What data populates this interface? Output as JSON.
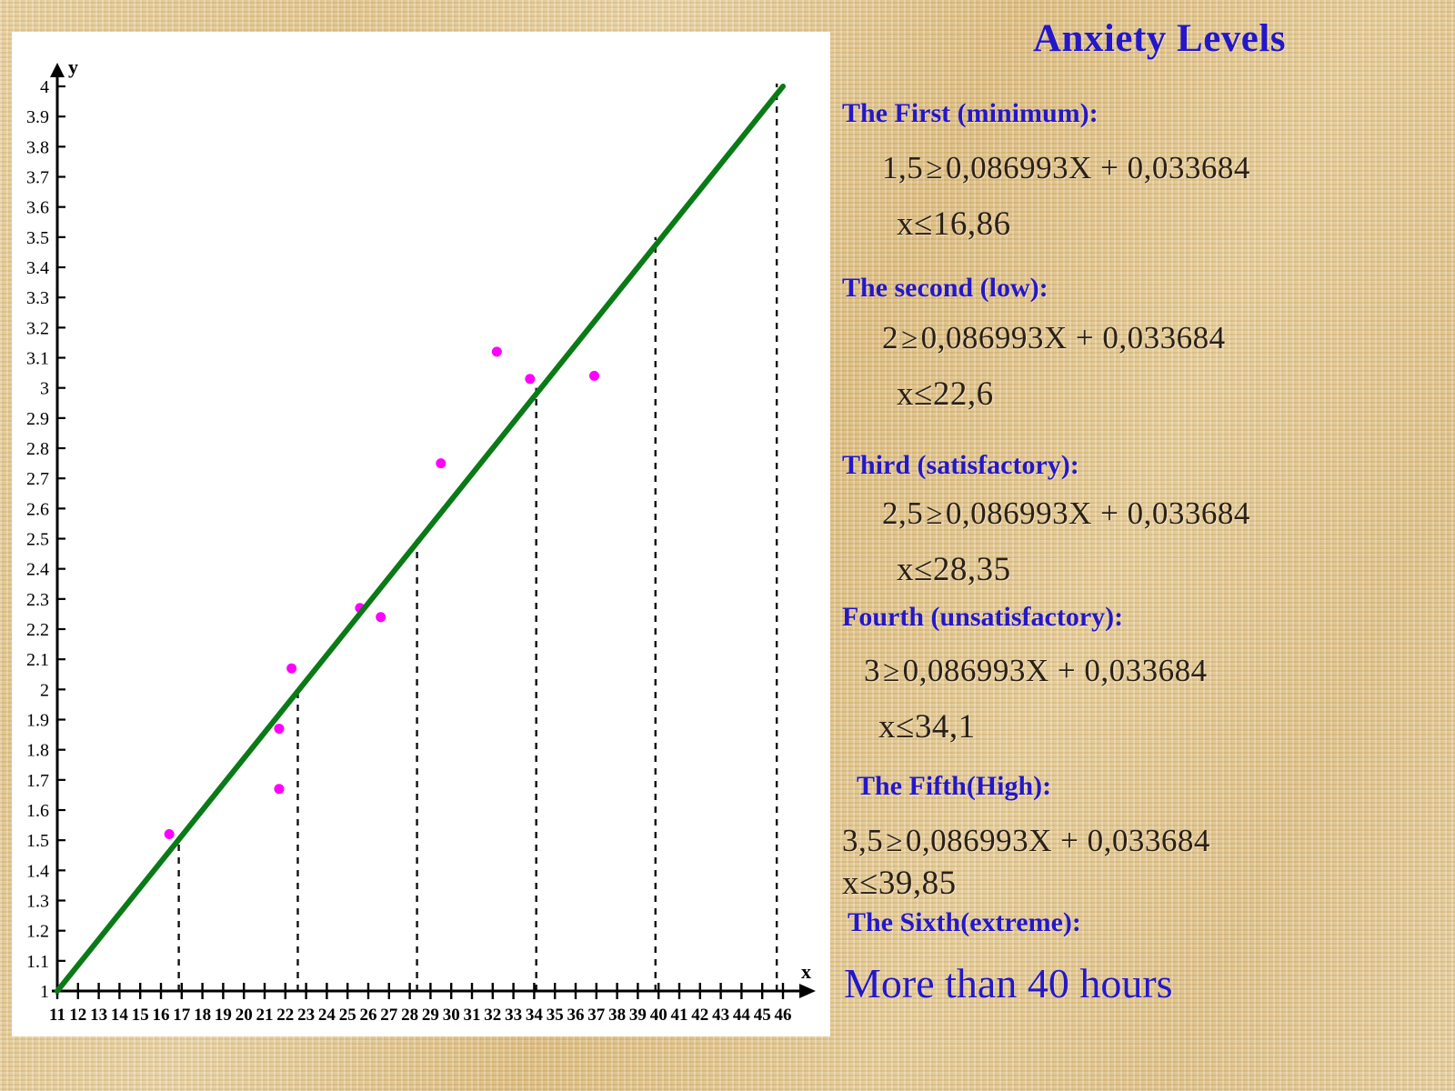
{
  "title": "Anxiety Levels",
  "colors": {
    "heading": "#2417c8",
    "formula": "#2b2014",
    "regression_line": "#0a7a16",
    "points": "#ff00ff",
    "background": "#e3c88f",
    "panel": "#ffffff"
  },
  "levels": [
    {
      "heading": "The First (minimum):",
      "formula_left": "1,5",
      "formula_rel": "≥",
      "formula_right": "0,086993X + 0,033684",
      "solution_var": "x",
      "solution_rel": "≤",
      "solution_value": "16,86"
    },
    {
      "heading": "The  second (low):",
      "formula_left": "2",
      "formula_rel": "≥",
      "formula_right": "0,086993X + 0,033684",
      "solution_var": "x",
      "solution_rel": "≤",
      "solution_value": "22,6"
    },
    {
      "heading": "Third (satisfactory):",
      "formula_left": "2,5",
      "formula_rel": "≥",
      "formula_right": "0,086993X + 0,033684",
      "solution_var": "x",
      "solution_rel": "≤",
      "solution_value": "28,35"
    },
    {
      "heading": "Fourth (unsatisfactory):",
      "formula_left": "3",
      "formula_rel": "≥",
      "formula_right": "0,086993X + 0,033684",
      "solution_var": "x",
      "solution_rel": "≤",
      "solution_value": "34,1"
    },
    {
      "heading": "The Fifth(High):",
      "formula_left": "3,5",
      "formula_rel": "≥",
      "formula_right": "0,086993X + 0,033684",
      "solution_var": "x",
      "solution_rel": "≤",
      "solution_value": "39,85"
    },
    {
      "heading": "The Sixth(extreme):",
      "conclusion": "More than 40 hours"
    }
  ],
  "chart_data": {
    "type": "scatter",
    "title": "",
    "xlabel": "x",
    "ylabel": "y",
    "xlim": [
      11,
      46
    ],
    "ylim": [
      1,
      4
    ],
    "xticks": [
      11,
      12,
      13,
      14,
      15,
      16,
      17,
      18,
      19,
      20,
      21,
      22,
      23,
      24,
      25,
      26,
      27,
      28,
      29,
      30,
      31,
      32,
      33,
      34,
      35,
      36,
      37,
      38,
      39,
      40,
      41,
      42,
      43,
      44,
      45,
      46
    ],
    "yticks": [
      1,
      1.1,
      1.2,
      1.3,
      1.4,
      1.5,
      1.6,
      1.7,
      1.8,
      1.9,
      2,
      2.1,
      2.2,
      2.3,
      2.4,
      2.5,
      2.6,
      2.7,
      2.8,
      2.9,
      3,
      3.1,
      3.2,
      3.3,
      3.4,
      3.5,
      3.6,
      3.7,
      3.8,
      3.9,
      4
    ],
    "ytick_labels": [
      "1",
      "1.1",
      "1.2",
      "1.3",
      "1.4",
      "1.5",
      "1.6",
      "1.7",
      "1.8",
      "1.9",
      "2",
      "2.1",
      "2.2",
      "2.3",
      "2.4",
      "2.5",
      "2.6",
      "2.7",
      "2.8",
      "2.9",
      "3",
      "3.1",
      "3.2",
      "3.3",
      "3.4",
      "3.5",
      "3.6",
      "3.7",
      "3.8",
      "3.9",
      "4"
    ],
    "grid": false,
    "legend": "none",
    "series": [
      {
        "name": "observations",
        "type": "scatter",
        "color": "#ff00ff",
        "points": [
          {
            "x": 16.4,
            "y": 1.52
          },
          {
            "x": 21.7,
            "y": 1.67
          },
          {
            "x": 21.7,
            "y": 1.87
          },
          {
            "x": 22.3,
            "y": 2.07
          },
          {
            "x": 25.6,
            "y": 2.27
          },
          {
            "x": 26.6,
            "y": 2.24
          },
          {
            "x": 29.5,
            "y": 2.75
          },
          {
            "x": 32.2,
            "y": 3.12
          },
          {
            "x": 33.8,
            "y": 3.03
          },
          {
            "x": 36.9,
            "y": 3.04
          }
        ]
      },
      {
        "name": "regression line",
        "type": "line",
        "color": "#0a7a16",
        "equation": "y = 0,086993x + 0,033684",
        "x": [
          11,
          46
        ],
        "values": [
          1.0,
          4.0
        ]
      }
    ],
    "threshold_lines": [
      {
        "x": 16.86,
        "label": "16,86",
        "style": "dashed"
      },
      {
        "x": 22.6,
        "label": "22,6",
        "style": "dashed"
      },
      {
        "x": 28.35,
        "label": "28,35",
        "style": "dashed"
      },
      {
        "x": 34.1,
        "label": "34,1",
        "style": "dashed"
      },
      {
        "x": 39.85,
        "label": "39,85",
        "style": "dashed"
      },
      {
        "x": 45.7,
        "label": "",
        "style": "dashed"
      }
    ]
  }
}
